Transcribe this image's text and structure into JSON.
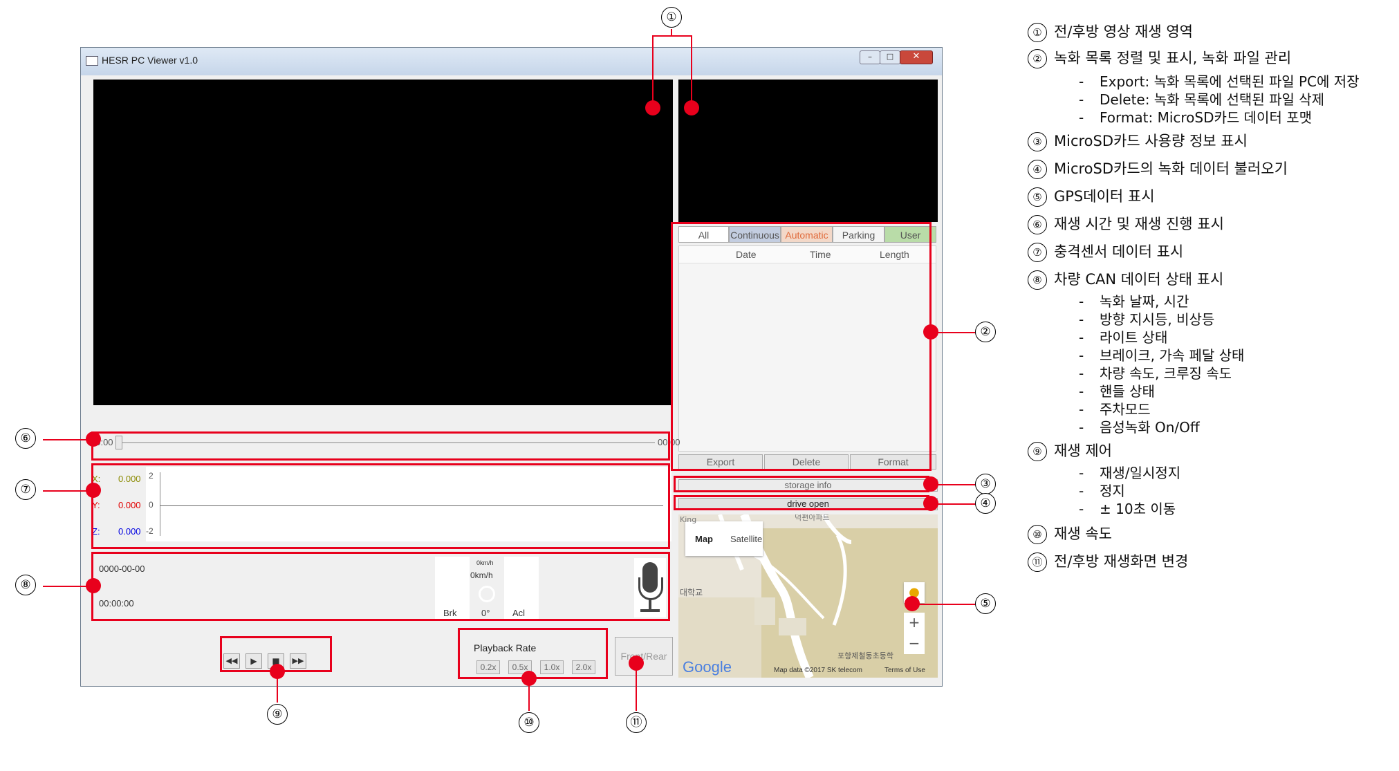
{
  "window": {
    "title": "HESR PC Viewer v1.0"
  },
  "callouts": [
    "①",
    "②",
    "③",
    "④",
    "⑤",
    "⑥",
    "⑦",
    "⑧",
    "⑨",
    "⑩",
    "⑪"
  ],
  "tabs": [
    "All",
    "Continuous",
    "Automatic",
    "Parking",
    "User"
  ],
  "tab_colors": {
    "continuous": "#c3cde0",
    "automatic": "#f3d8c8",
    "user": "#b9dca8"
  },
  "columns": [
    "Date",
    "Time",
    "Length"
  ],
  "list_buttons": {
    "export": "Export",
    "delete": "Delete",
    "format": "Format"
  },
  "storage_info": "storage info",
  "drive_open": "drive open",
  "timeline": {
    "start": "00:00",
    "end": "00:00"
  },
  "gsensor": {
    "x_label": "X:",
    "x_value": "0.000",
    "y_label": "Y:",
    "y_value": "0.000",
    "z_label": "Z:",
    "z_value": "0.000",
    "tick_top": "2",
    "tick_mid": "0",
    "tick_bottom": "-2",
    "colors": {
      "x": "#8a8a00",
      "y": "#e00000",
      "z": "#0000e0"
    }
  },
  "can": {
    "date": "0000-00-00",
    "time": "00:00:00",
    "speed_small": "0km/h",
    "speed": "0km/h",
    "brake": "Brk",
    "steer": "0°",
    "accel": "Acl"
  },
  "map": {
    "tab_map": "Map",
    "tab_satellite": "Satellite",
    "label_king": "King",
    "label_school": "대학교",
    "label_top": "덕편아파트",
    "label_station": "포항제철동초등학",
    "attribution": "Map data ©2017 SK telecom",
    "terms": "Terms of Use",
    "google": "Google"
  },
  "playback_rate": {
    "title": "Playback Rate",
    "options": [
      "0.2x",
      "0.5x",
      "1.0x",
      "2.0x"
    ]
  },
  "front_rear": "Front/Rear",
  "legend": [
    {
      "n": "①",
      "text": "전/후방 영상 재생 영역"
    },
    {
      "n": "②",
      "text": "녹화 목록 정렬 및 표시, 녹화 파일 관리"
    },
    {
      "n": "③",
      "text": "MicroSD카드 사용량 정보 표시"
    },
    {
      "n": "④",
      "text": "MicroSD카드의 녹화 데이터 불러오기"
    },
    {
      "n": "⑤",
      "text": "GPS데이터 표시"
    },
    {
      "n": "⑥",
      "text": "재생 시간 및 재생 진행 표시"
    },
    {
      "n": "⑦",
      "text": "충격센서 데이터 표시"
    },
    {
      "n": "⑧",
      "text": "차량 CAN 데이터 상태 표시"
    },
    {
      "n": "⑨",
      "text": "재생 제어"
    },
    {
      "n": "⑩",
      "text": "재생 속도"
    },
    {
      "n": "⑪",
      "text": "전/후방 재생화면 변경"
    }
  ],
  "legend_sub_2": [
    "Export: 녹화 목록에 선택된 파일 PC에 저장",
    "Delete: 녹화 목록에 선택된 파일 삭제",
    "Format: MicroSD카드 데이터 포맷"
  ],
  "legend_sub_8": [
    "녹화 날짜, 시간",
    "방향 지시등, 비상등",
    "라이트 상태",
    "브레이크, 가속 페달 상태",
    "차량 속도, 크루징 속도",
    "핸들 상태",
    "주차모드",
    "음성녹화 On/Off"
  ],
  "legend_sub_9": [
    "재생/일시정지",
    "정지",
    "± 10초 이동"
  ],
  "accent": "#e8001c"
}
